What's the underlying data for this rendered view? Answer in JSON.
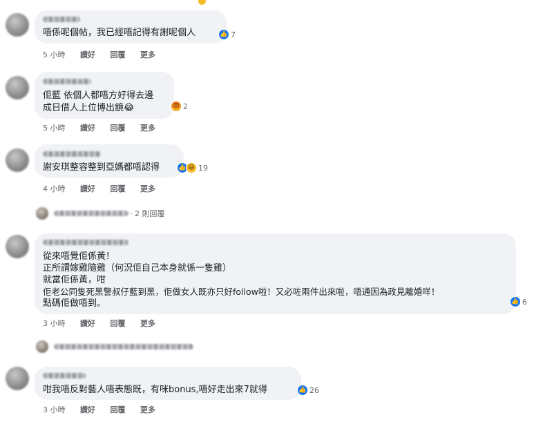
{
  "comments": [
    {
      "lines": [
        "唔係呢個帖，我已經唔記得有謝呢個人"
      ],
      "reactions": [
        "like"
      ],
      "count": "7",
      "time": "5 小時",
      "actions": [
        "讚好",
        "回覆",
        "更多"
      ]
    },
    {
      "lines": [
        "佢藍 依個人都唔方好得去邊",
        "成日借人上位博出鏡😂"
      ],
      "reactions": [
        "angry"
      ],
      "count": "2",
      "time": "5 小時",
      "actions": [
        "讚好",
        "回覆",
        "更多"
      ]
    },
    {
      "lines": [
        "謝安琪整容整到亞媽都唔認得"
      ],
      "reactions": [
        "like",
        "haha"
      ],
      "count": "19",
      "time": "4 小時",
      "actions": [
        "讚好",
        "回覆",
        "更多"
      ]
    },
    {
      "lines": [
        "從來唔覺佢係黃！",
        "正所謂嫁雞隨雞（何況佢自己本身就係一隻雞）",
        "就當佢係黃，咁",
        "佢老公同隻死黑警叔仔藍到黑，佢做女人既亦只好follow啦！又必咗兩件出來啦，唔通因為政見離婚咩！",
        "點碼佢做唔到。"
      ],
      "reactions": [
        "like"
      ],
      "count": "6",
      "time": "3 小時",
      "actions": [
        "讚好",
        "回覆",
        "更多"
      ]
    },
    {
      "lines": [
        "咁我唔反對藝人唔表態既，有咪bonus,唔好走出來7就得"
      ],
      "reactions": [
        "like"
      ],
      "count": "26",
      "time": "3 小時",
      "actions": [
        "讚好",
        "回覆",
        "更多"
      ]
    }
  ],
  "replies": [
    {
      "text": "· 2 則回覆"
    }
  ],
  "colors": {
    "bubble": "#f0f2f5",
    "like": "#1877f2",
    "secondary_text": "#65676b"
  }
}
